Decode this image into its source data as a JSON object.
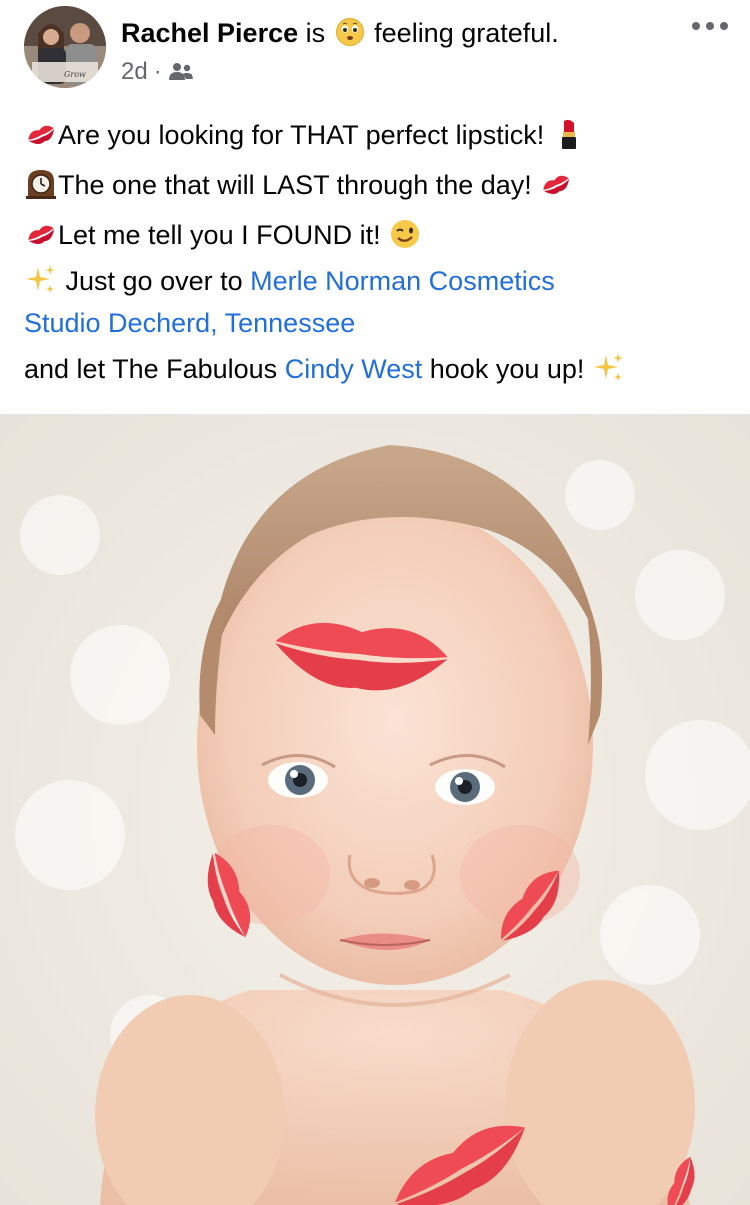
{
  "post": {
    "author": "Rachel Pierce",
    "is_text": "is",
    "feeling_text": "feeling grateful.",
    "time": "2d",
    "separator": "·",
    "audience_icon": "friends-icon",
    "more_icon": "more-options-icon"
  },
  "body": {
    "line1": "Are you looking for THAT perfect lipstick!",
    "line2": "The one that will LAST through the day!",
    "line3": "Let me tell you I FOUND it!",
    "line4_prefix": "Just go over to",
    "line4_link": "Merle Norman Cosmetics",
    "line5_link": "Studio Decherd, Tennessee",
    "line6_prefix": "and let The Fabulous",
    "line6_link": "Cindy West",
    "line6_suffix": "hook you up!",
    "emojis": [
      "kiss-mark-icon",
      "lipstick-icon",
      "clock-icon",
      "winking-face-icon",
      "sparkles-icon",
      "grateful-face-icon"
    ]
  },
  "colors": {
    "link": "#216fdb",
    "meta_gray": "#65676b",
    "text": "#050505"
  }
}
